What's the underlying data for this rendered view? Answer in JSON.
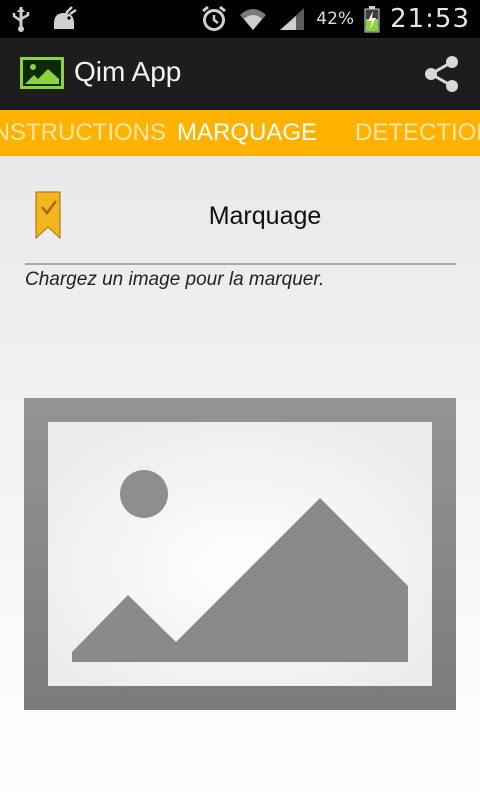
{
  "status_bar": {
    "icons_left": [
      "usb-icon",
      "android-debug-icon"
    ],
    "icons_right": [
      "alarm-icon",
      "wifi-icon",
      "signal-icon",
      "battery-charging-icon"
    ],
    "battery_percent": "42%",
    "time": "21:53"
  },
  "action_bar": {
    "app_icon": "gallery-image-icon",
    "title": "Qim App",
    "share_icon": "share-icon"
  },
  "tabs": [
    {
      "label": "INSTRUCTIONS",
      "active": false
    },
    {
      "label": "MARQUAGE",
      "active": true
    },
    {
      "label": "DETECTION",
      "active": false
    }
  ],
  "section": {
    "icon": "bookmark-check-icon",
    "title": "Marquage",
    "instruction": "Chargez un image pour la marquer.",
    "image_placeholder_icon": "image-placeholder-icon"
  },
  "colors": {
    "tab_background": "#ffb300",
    "action_bar": "#1d1d1d",
    "accent_green": "#8bd43d",
    "bookmark": "#f5b51e"
  }
}
